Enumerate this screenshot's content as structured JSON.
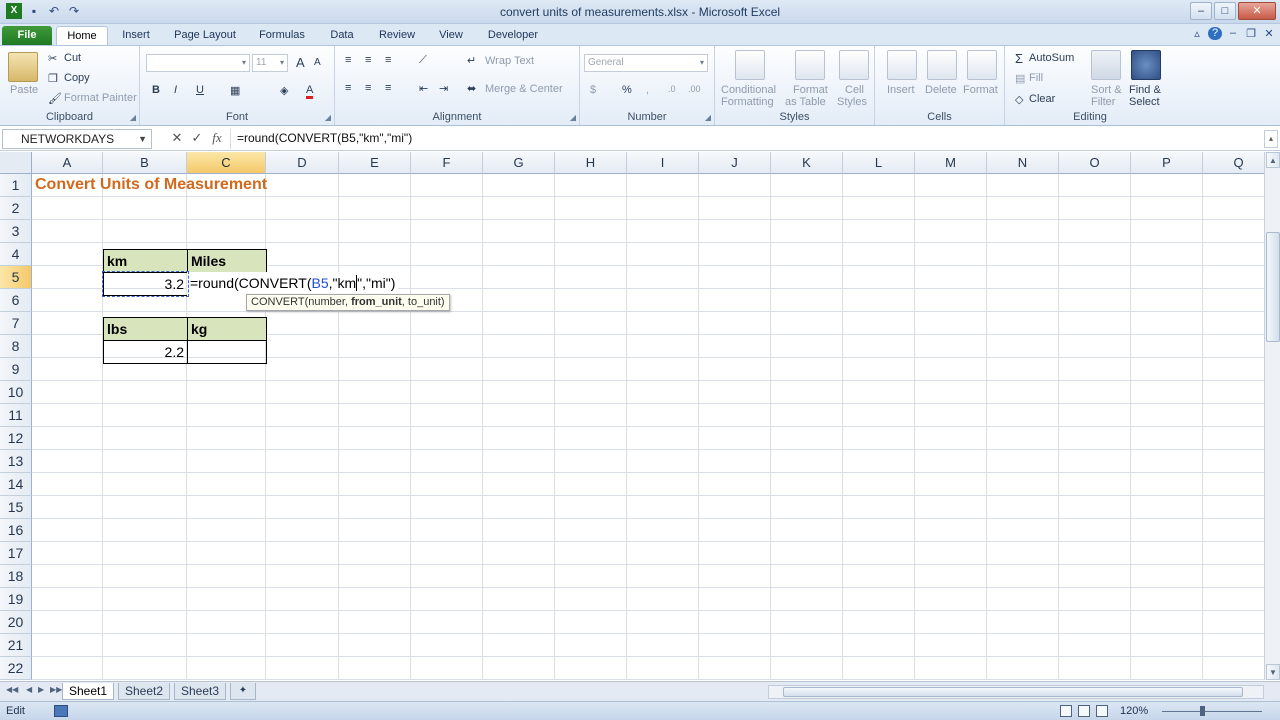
{
  "window": {
    "title": "convert units of measurements.xlsx - Microsoft Excel",
    "qat_icons": [
      "excel-logo-icon",
      "save-icon",
      "undo-icon",
      "redo-icon"
    ],
    "controls": [
      "minimize-icon",
      "maximize-icon",
      "close-icon"
    ]
  },
  "tabs": [
    "File",
    "Home",
    "Insert",
    "Page Layout",
    "Formulas",
    "Data",
    "Review",
    "View",
    "Developer"
  ],
  "active_tab": "Home",
  "ribbon": {
    "clipboard": {
      "label": "Clipboard",
      "paste": "Paste",
      "cut": "Cut",
      "copy": "Copy",
      "format_painter": "Format Painter"
    },
    "font": {
      "label": "Font",
      "font_name": "",
      "font_size": "11",
      "bold": "B",
      "italic": "I",
      "underline": "U",
      "grow": "A",
      "shrink": "A"
    },
    "alignment": {
      "label": "Alignment",
      "wrap_text": "Wrap Text",
      "merge_center": "Merge & Center"
    },
    "number": {
      "label": "Number",
      "format": "General",
      "currency": "$",
      "percent": "%",
      "comma": ",",
      "inc_decimal": ".0",
      "dec_decimal": ".00"
    },
    "styles": {
      "label": "Styles",
      "conditional": "Conditional",
      "conditional2": "Formatting",
      "format_table": "Format",
      "format_table2": "as Table",
      "cell_styles": "Cell",
      "cell_styles2": "Styles"
    },
    "cells": {
      "label": "Cells",
      "insert": "Insert",
      "delete": "Delete",
      "format": "Format"
    },
    "editing": {
      "label": "Editing",
      "autosum": "AutoSum",
      "fill": "Fill",
      "clear": "Clear",
      "sort": "Sort &",
      "sort2": "Filter",
      "find": "Find &",
      "find2": "Select"
    }
  },
  "formula_bar": {
    "name_box": "NETWORKDAYS",
    "cancel": "✕",
    "enter": "✓",
    "fx": "fx",
    "formula": "=round(CONVERT(B5,\"km\",\"mi\")"
  },
  "columns": [
    "A",
    "B",
    "C",
    "D",
    "E",
    "F",
    "G",
    "H",
    "I",
    "J",
    "K",
    "L",
    "M",
    "N",
    "O",
    "P",
    "Q"
  ],
  "rows": [
    "1",
    "2",
    "3",
    "4",
    "5",
    "6",
    "7",
    "8",
    "9",
    "10",
    "11",
    "12",
    "13",
    "14",
    "15",
    "16",
    "17",
    "18",
    "19",
    "20",
    "21",
    "22"
  ],
  "selected_column": "C",
  "selected_row": "5",
  "cells": {
    "A1": "Convert Units of Measurement",
    "B4": "km",
    "C4": "Miles",
    "B5": "3.2",
    "C5_parts": {
      "eq": "=round(CONVERT(",
      "ref": "B5",
      "arg1": ",\"km",
      "arg2": "\",\"mi\")"
    },
    "B7": "lbs",
    "C7": "kg",
    "B8": "2.2",
    "C8": ""
  },
  "tooltip": {
    "func": "CONVERT(number, ",
    "bold_arg": "from_unit",
    "rest": ", to_unit)"
  },
  "sheets": [
    "Sheet1",
    "Sheet2",
    "Sheet3"
  ],
  "active_sheet": "Sheet1",
  "status": {
    "mode": "Edit",
    "zoom": "120%"
  }
}
